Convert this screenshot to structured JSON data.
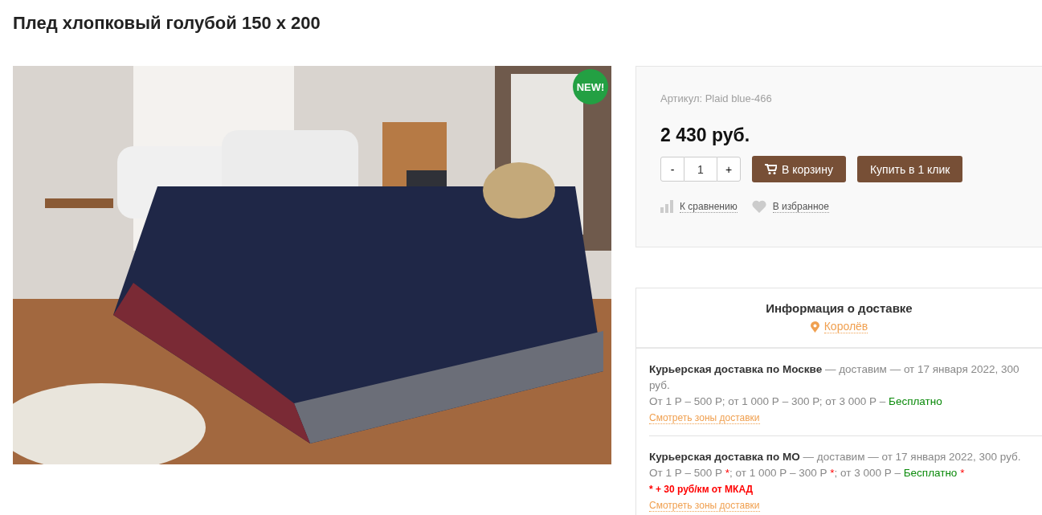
{
  "page_title": "Плед хлопковый голубой 150 х 200",
  "product_image": {
    "badge": "NEW!"
  },
  "buy_panel": {
    "sku": "Артикул: Plaid blue-466",
    "price": "2 430 руб.",
    "quantity": {
      "minus": "-",
      "value": "1",
      "plus": "+"
    },
    "buttons": [
      {
        "kind": "cart",
        "label": "В корзину"
      },
      {
        "kind": "plain",
        "label": "Купить в 1 клик"
      }
    ],
    "links": [
      {
        "kind": "compare",
        "label": "К сравнению"
      },
      {
        "kind": "favorite",
        "label": "В избранное"
      }
    ]
  },
  "delivery": {
    "title": "Информация о доставке",
    "city": "Королёв",
    "options": [
      {
        "summary": "**Курьерская доставка по Москве** — доставим — от 17 января 2022, 300 руб.",
        "prices": [
          {
            "kind": "text",
            "text": "От 1 Р – 500 Р; от 1 000 Р – 300 Р; от 3 000 Р – "
          },
          {
            "kind": "free",
            "text": "Бесплатно"
          }
        ],
        "link": "Смотреть зоны доставки"
      },
      {
        "summary": "**Курьерская доставка по МО**  — доставим — от 17 января 2022, 300 руб.",
        "prices": [
          {
            "kind": "text",
            "text": "От 1 Р – 500 Р "
          },
          {
            "kind": "star",
            "text": "*"
          },
          {
            "kind": "text",
            "text": "; от 1 000 Р – 300 Р "
          },
          {
            "kind": "star",
            "text": "*"
          },
          {
            "kind": "text",
            "text": "; от 3 000 Р – "
          },
          {
            "kind": "free",
            "text": "Бесплатно"
          },
          {
            "kind": "star",
            "text": " *"
          }
        ],
        "note": "* + 30 руб/км от МКАД",
        "link": "Смотреть зоны доставки"
      }
    ]
  }
}
